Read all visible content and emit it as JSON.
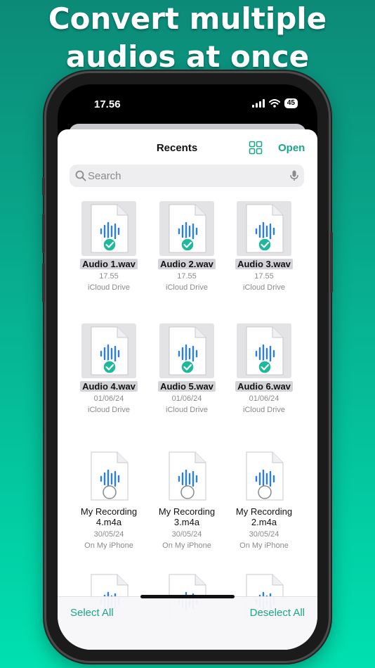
{
  "headline": {
    "line1": "Convert multiple",
    "line2": "audios at once"
  },
  "status_bar": {
    "time": "17.56",
    "battery": "45"
  },
  "nav": {
    "title": "Recents",
    "open_label": "Open"
  },
  "search": {
    "placeholder": "Search"
  },
  "files": [
    {
      "name": "Audio 1.wav",
      "date": "17.55",
      "location": "iCloud Drive",
      "selected": true
    },
    {
      "name": "Audio 2.wav",
      "date": "17.55",
      "location": "iCloud Drive",
      "selected": true
    },
    {
      "name": "Audio 3.wav",
      "date": "17.55",
      "location": "iCloud Drive",
      "selected": true
    },
    {
      "name": "Audio 4.wav",
      "date": "01/06/24",
      "location": "iCloud Drive",
      "selected": true
    },
    {
      "name": "Audio 5.wav",
      "date": "01/06/24",
      "location": "iCloud Drive",
      "selected": true
    },
    {
      "name": "Audio 6.wav",
      "date": "01/06/24",
      "location": "iCloud Drive",
      "selected": true
    },
    {
      "name_line1": "My Recording",
      "name_line2": "4.m4a",
      "date": "30/05/24",
      "location": "On My iPhone",
      "selected": false
    },
    {
      "name_line1": "My Recording",
      "name_line2": "3.m4a",
      "date": "30/05/24",
      "location": "On My iPhone",
      "selected": false
    },
    {
      "name_line1": "My Recording",
      "name_line2": "2.m4a",
      "date": "30/05/24",
      "location": "On My iPhone",
      "selected": false
    }
  ],
  "bottom_bar": {
    "select_all": "Select All",
    "deselect_all": "Deselect All"
  },
  "colors": {
    "accent": "#1aa58c",
    "waveform": "#2b7fd6",
    "check": "#1eb89a"
  }
}
